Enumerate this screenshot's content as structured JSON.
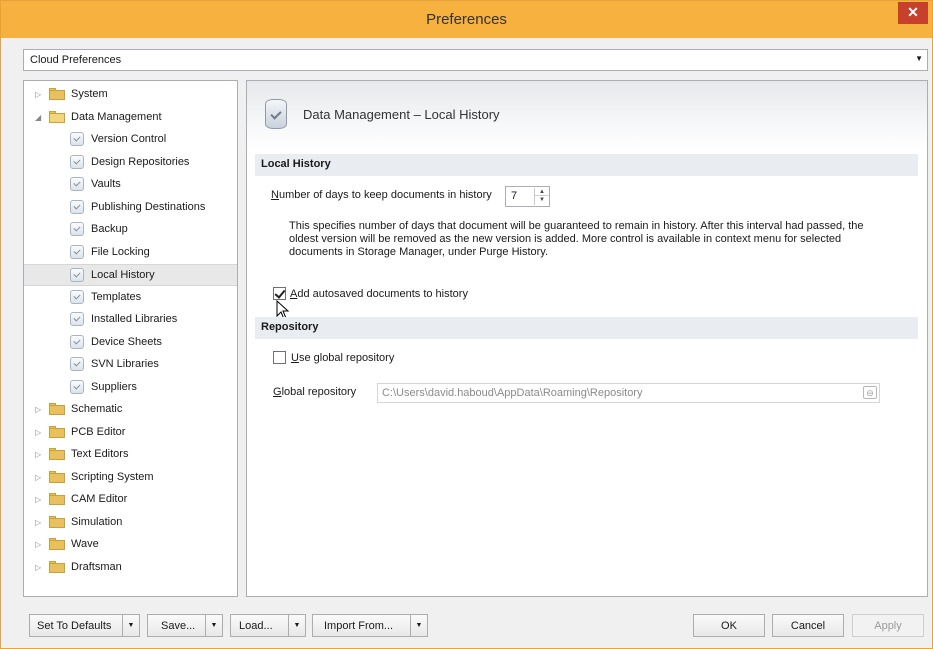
{
  "window": {
    "title": "Preferences",
    "close_glyph": "✕"
  },
  "cloud_select": {
    "value": "Cloud Preferences",
    "arrow": "▼"
  },
  "tree": {
    "collapsed_glyph": "▷",
    "expanded_glyph": "◢",
    "items": [
      {
        "label": "System",
        "level": 0,
        "type": "folder",
        "expanded": false
      },
      {
        "label": "Data Management",
        "level": 0,
        "type": "folder",
        "expanded": true
      },
      {
        "label": "Version Control",
        "level": 1,
        "type": "leaf"
      },
      {
        "label": "Design Repositories",
        "level": 1,
        "type": "leaf"
      },
      {
        "label": "Vaults",
        "level": 1,
        "type": "leaf"
      },
      {
        "label": "Publishing Destinations",
        "level": 1,
        "type": "leaf"
      },
      {
        "label": "Backup",
        "level": 1,
        "type": "leaf"
      },
      {
        "label": "File Locking",
        "level": 1,
        "type": "leaf"
      },
      {
        "label": "Local History",
        "level": 1,
        "type": "leaf",
        "selected": true
      },
      {
        "label": "Templates",
        "level": 1,
        "type": "leaf"
      },
      {
        "label": "Installed Libraries",
        "level": 1,
        "type": "leaf"
      },
      {
        "label": "Device Sheets",
        "level": 1,
        "type": "leaf"
      },
      {
        "label": "SVN Libraries",
        "level": 1,
        "type": "leaf"
      },
      {
        "label": "Suppliers",
        "level": 1,
        "type": "leaf"
      },
      {
        "label": "Schematic",
        "level": 0,
        "type": "folder",
        "expanded": false
      },
      {
        "label": "PCB Editor",
        "level": 0,
        "type": "folder",
        "expanded": false
      },
      {
        "label": "Text Editors",
        "level": 0,
        "type": "folder",
        "expanded": false
      },
      {
        "label": "Scripting System",
        "level": 0,
        "type": "folder",
        "expanded": false
      },
      {
        "label": "CAM Editor",
        "level": 0,
        "type": "folder",
        "expanded": false
      },
      {
        "label": "Simulation",
        "level": 0,
        "type": "folder",
        "expanded": false
      },
      {
        "label": "Wave",
        "level": 0,
        "type": "folder",
        "expanded": false
      },
      {
        "label": "Draftsman",
        "level": 0,
        "type": "folder",
        "expanded": false
      }
    ]
  },
  "panel": {
    "title": "Data Management – Local History",
    "local_history": {
      "section_title": "Local History",
      "days_label_prefix": "N",
      "days_label_rest": "umber of days to keep documents in history",
      "days_value": "7",
      "spin_up": "▲",
      "spin_down": "▼",
      "description": "This specifies number of days that document will be guaranteed to remain in history. After this interval had passed, the oldest version will be removed as the new version is added. More control is available in context menu for selected documents in Storage Manager, under Purge History.",
      "autosave_prefix": "A",
      "autosave_rest": "dd autosaved documents to history",
      "autosave_checked": true
    },
    "repository": {
      "section_title": "Repository",
      "use_global_prefix": "U",
      "use_global_rest": "se global repository",
      "use_global_checked": false,
      "global_label_prefix": "G",
      "global_label_rest": "lobal repository",
      "global_path": "C:\\Users\\david.haboud\\AppData\\Roaming\\Repository",
      "browse_glyph": "⊖"
    }
  },
  "footer": {
    "dropdown_glyph": "▼",
    "set_defaults": "Set To Defaults",
    "save": "Save...",
    "load": "Load...",
    "import_from": "Import From...",
    "ok": "OK",
    "cancel": "Cancel",
    "apply": "Apply"
  }
}
